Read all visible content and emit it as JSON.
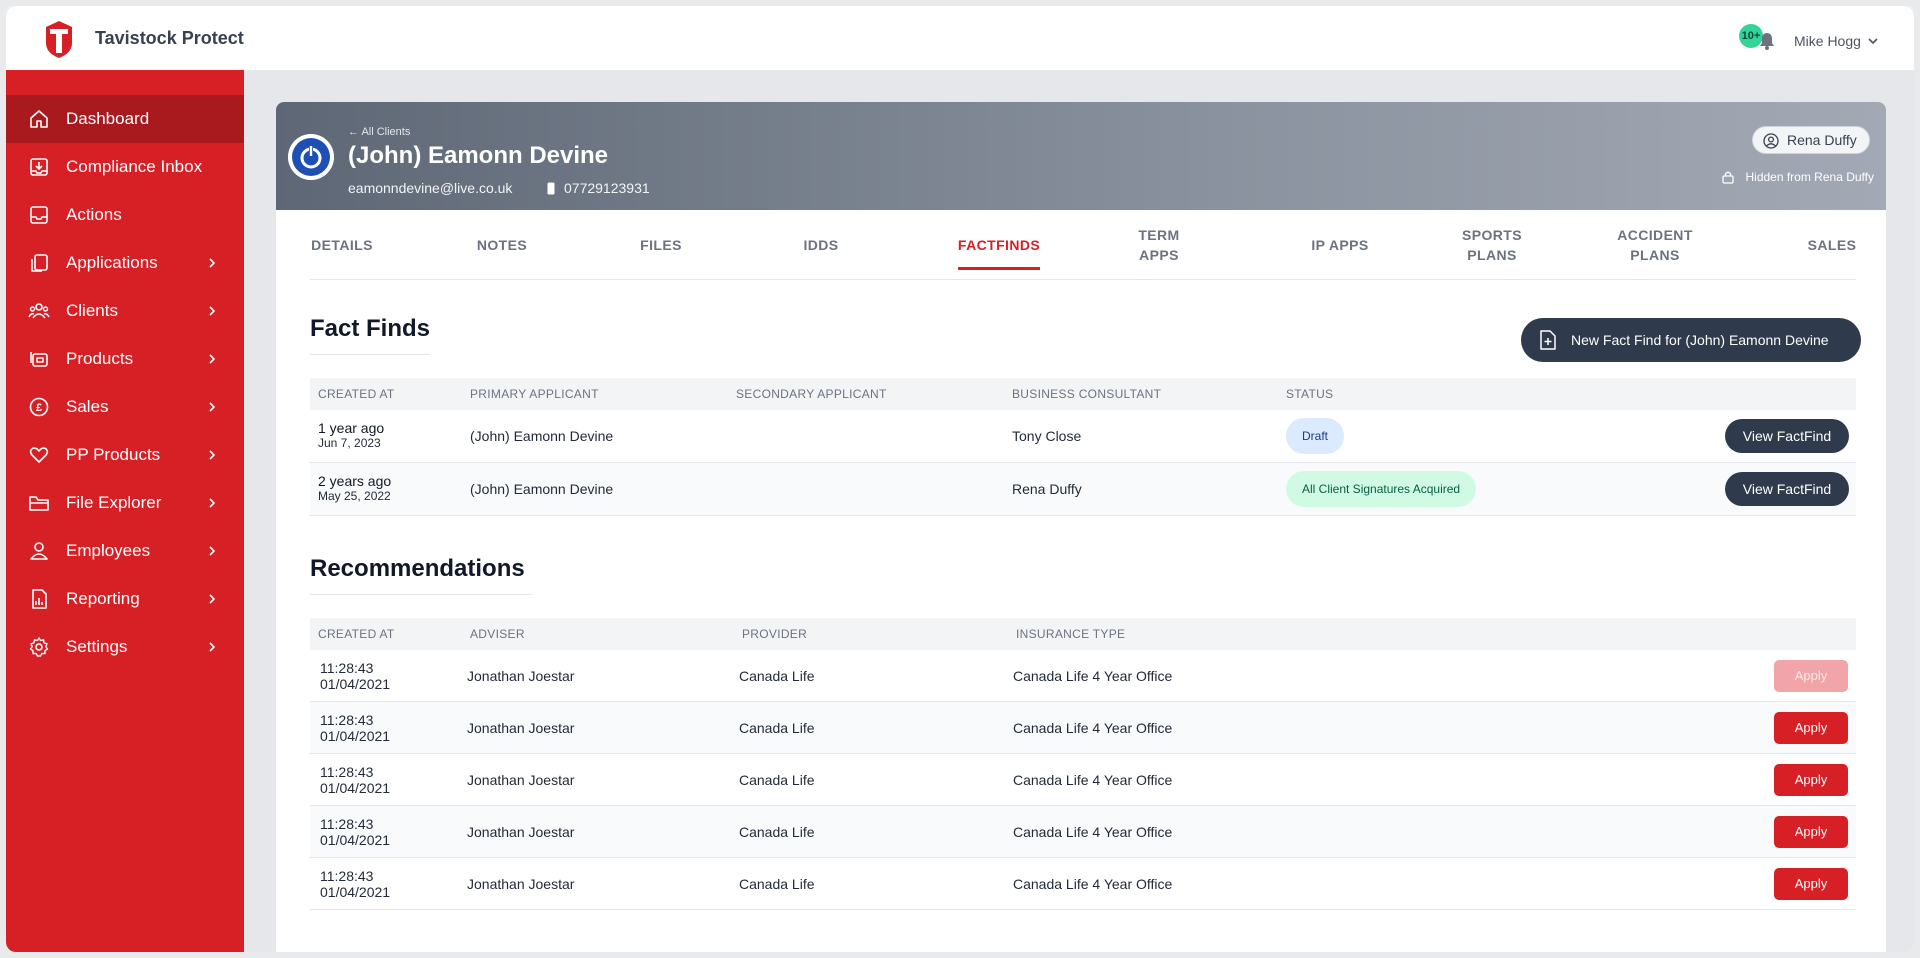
{
  "app": {
    "brand": "Tavistock Protect",
    "brand_color": "#d71f26"
  },
  "topbar": {
    "notification_count": "10+",
    "user_name": "Mike Hogg"
  },
  "sidebar": {
    "items": [
      {
        "label": "Dashboard",
        "icon": "home-icon",
        "active": true,
        "has_chevron": false
      },
      {
        "label": "Compliance Inbox",
        "icon": "inbox-download-icon",
        "has_chevron": false
      },
      {
        "label": "Actions",
        "icon": "tray-icon",
        "has_chevron": false
      },
      {
        "label": "Applications",
        "icon": "documents-icon",
        "has_chevron": true
      },
      {
        "label": "Clients",
        "icon": "users-icon",
        "has_chevron": true
      },
      {
        "label": "Products",
        "icon": "products-icon",
        "has_chevron": true
      },
      {
        "label": "Sales",
        "icon": "pound-icon",
        "has_chevron": true
      },
      {
        "label": "PP Products",
        "icon": "heart-icon",
        "has_chevron": true
      },
      {
        "label": "File Explorer",
        "icon": "folder-icon",
        "has_chevron": true
      },
      {
        "label": "Employees",
        "icon": "user-icon",
        "has_chevron": true
      },
      {
        "label": "Reporting",
        "icon": "report-icon",
        "has_chevron": true
      },
      {
        "label": "Settings",
        "icon": "gear-icon",
        "has_chevron": true
      }
    ]
  },
  "client": {
    "back_label": "← All Clients",
    "name": "(John) Eamonn Devine",
    "email": "eamonndevine@live.co.uk",
    "phone": "07729123931",
    "owner": "Rena Duffy",
    "hidden_note": "Hidden from Rena Duffy"
  },
  "tabs": [
    {
      "label": "DETAILS"
    },
    {
      "label": "NOTES"
    },
    {
      "label": "FILES"
    },
    {
      "label": "IDDS"
    },
    {
      "label": "FACTFINDS",
      "active": true
    },
    {
      "label": "TERM\nAPPS"
    },
    {
      "label": "IP APPS"
    },
    {
      "label": "SPORTS\nPLANS"
    },
    {
      "label": "ACCIDENT\nPLANS"
    },
    {
      "label": "SALES"
    }
  ],
  "factfinds": {
    "title": "Fact Finds",
    "new_button": "New Fact Find for (John) Eamonn Devine",
    "columns": [
      "CREATED AT",
      "PRIMARY APPLICANT",
      "SECONDARY APPLICANT",
      "BUSINESS CONSULTANT",
      "STATUS"
    ],
    "rows": [
      {
        "ago": "1 year ago",
        "date": "Jun 7, 2023",
        "primary": "(John) Eamonn Devine",
        "secondary": "",
        "consultant": "Tony Close",
        "status": "Draft",
        "status_kind": "draft",
        "action": "View FactFind"
      },
      {
        "ago": "2 years ago",
        "date": "May 25, 2022",
        "primary": "(John) Eamonn Devine",
        "secondary": "",
        "consultant": "Rena Duffy",
        "status": "All Client Signatures Acquired",
        "status_kind": "acquired",
        "action": "View FactFind"
      }
    ]
  },
  "recommendations": {
    "title": "Recommendations",
    "columns": [
      "CREATED AT",
      "ADVISER",
      "PROVIDER",
      "INSURANCE TYPE"
    ],
    "rows": [
      {
        "time": "11:28:43",
        "date": "01/04/2021",
        "adviser": "Jonathan Joestar",
        "provider": "Canada Life",
        "type": "Canada Life 4 Year Office",
        "action": "Apply",
        "disabled": true
      },
      {
        "time": "11:28:43",
        "date": "01/04/2021",
        "adviser": "Jonathan Joestar",
        "provider": "Canada Life",
        "type": "Canada Life 4 Year Office",
        "action": "Apply",
        "disabled": false
      },
      {
        "time": "11:28:43",
        "date": "01/04/2021",
        "adviser": "Jonathan Joestar",
        "provider": "Canada Life",
        "type": "Canada Life 4 Year Office",
        "action": "Apply",
        "disabled": false
      },
      {
        "time": "11:28:43",
        "date": "01/04/2021",
        "adviser": "Jonathan Joestar",
        "provider": "Canada Life",
        "type": "Canada Life 4 Year Office",
        "action": "Apply",
        "disabled": false
      },
      {
        "time": "11:28:43",
        "date": "01/04/2021",
        "adviser": "Jonathan Joestar",
        "provider": "Canada Life",
        "type": "Canada Life 4 Year Office",
        "action": "Apply",
        "disabled": false
      }
    ]
  }
}
